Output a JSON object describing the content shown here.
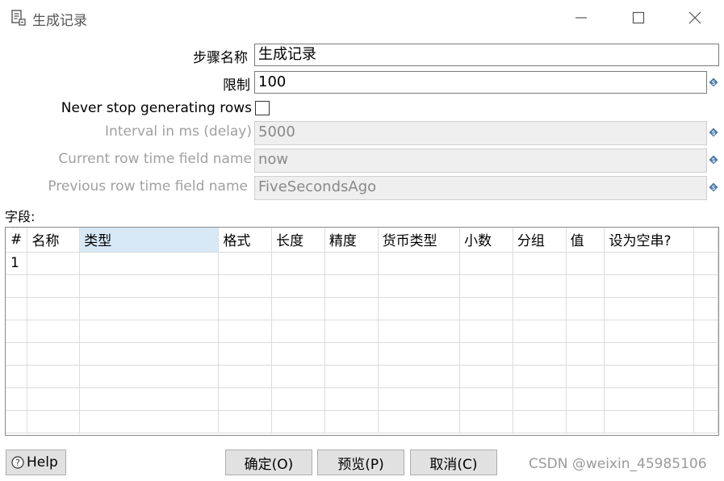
{
  "window": {
    "title": "生成记录",
    "icon": "document-list-icon",
    "controls": {
      "minimize": "—",
      "maximize": "☐",
      "close": "✕"
    }
  },
  "form": {
    "step_name": {
      "label": "步骤名称",
      "value": "生成记录"
    },
    "limit": {
      "label": "限制",
      "value": "100"
    },
    "never_stop": {
      "label": "Never stop generating rows",
      "checked": false
    },
    "interval": {
      "label": "Interval in ms (delay)",
      "value": "5000"
    },
    "current_time_field": {
      "label": "Current row time field name",
      "value": "now"
    },
    "previous_time_field": {
      "label": "Previous row time field name",
      "value": "FiveSecondsAgo"
    },
    "variable_icon": "$"
  },
  "fields": {
    "label": "字段:",
    "columns": [
      "#",
      "名称",
      "类型",
      "格式",
      "长度",
      "精度",
      "货币类型",
      "小数",
      "分组",
      "值",
      "设为空串?"
    ],
    "selected_column": "类型",
    "rows": [
      [
        "1",
        "",
        "",
        "",
        "",
        "",
        "",
        "",
        "",
        "",
        ""
      ]
    ]
  },
  "buttons": {
    "help": "Help",
    "ok": "确定(O)",
    "preview": "预览(P)",
    "cancel": "取消(C)"
  },
  "watermark": "CSDN @weixin_45985106",
  "colors": {
    "selected_header": "#d7e8f7",
    "variable_icon": "#4a7aa8"
  }
}
